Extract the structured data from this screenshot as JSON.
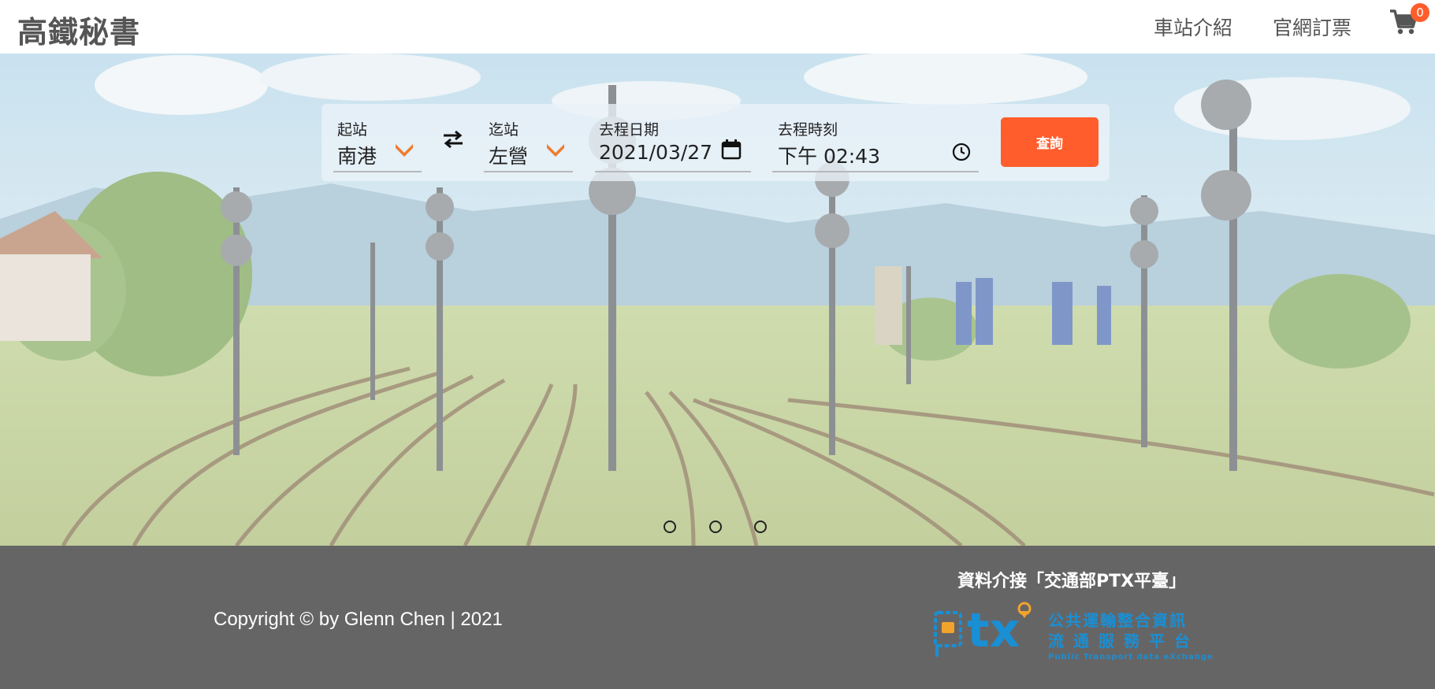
{
  "header": {
    "brand": "高鐵秘書",
    "nav": [
      "車站介紹",
      "官網訂票"
    ],
    "cart_count": "0",
    "cart_icon": "shopping-cart-icon"
  },
  "search": {
    "origin": {
      "label": "起站",
      "value": "南港"
    },
    "destination": {
      "label": "迄站",
      "value": "左營"
    },
    "date": {
      "label": "去程日期",
      "value": "2021/03/27"
    },
    "time": {
      "label": "去程時刻",
      "value": "下午 02:43"
    },
    "submit_label": "查詢",
    "swap_icon": "swap-icon",
    "accent": "#ff5e2c"
  },
  "carousel": {
    "slide_count": 3
  },
  "footer": {
    "copyright": "Copyright © by Glenn Chen | 2021",
    "ptx_caption": "資料介接「交通部PTX平臺」",
    "ptx_logo": {
      "letters": "tx",
      "cn_line1": "公共運輸整合資訊",
      "cn_line2": "流通服務平台",
      "en_line": "Public Transport data eXchange"
    }
  }
}
